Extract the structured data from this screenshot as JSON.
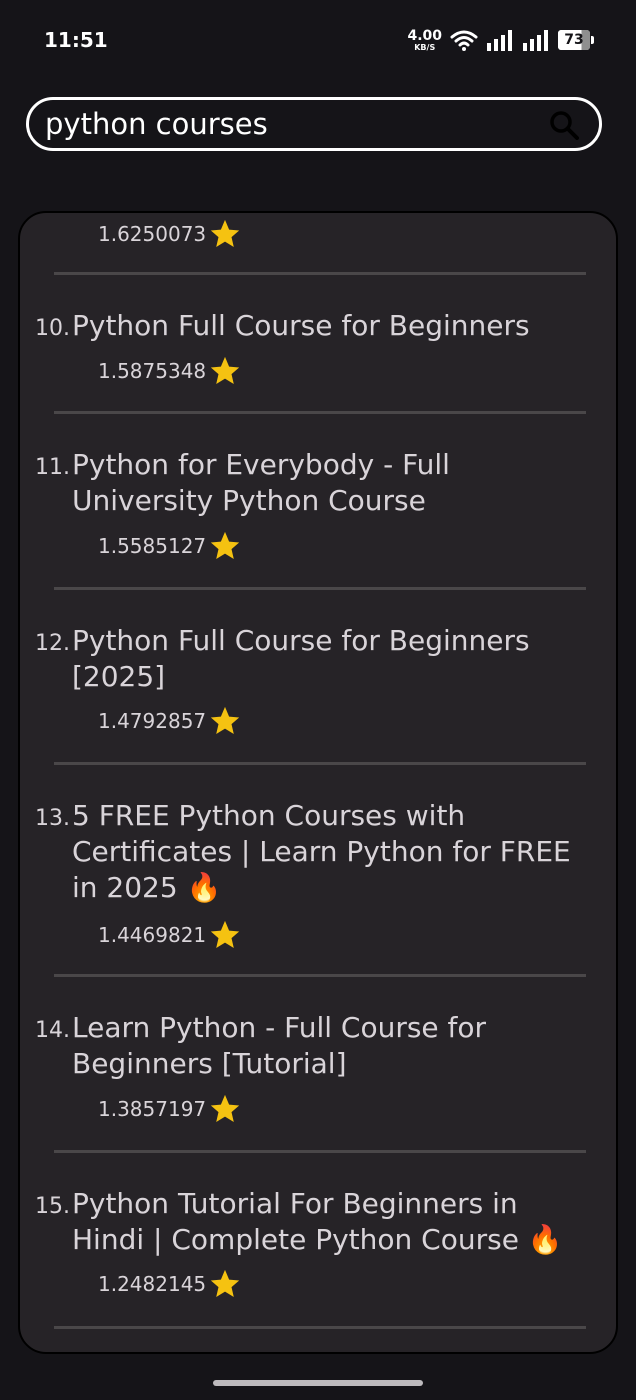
{
  "status_bar": {
    "time": "11:51",
    "net_speed_value": "4.00",
    "net_speed_unit": "KB/S",
    "battery": "73"
  },
  "search": {
    "value": "python courses",
    "placeholder": ""
  },
  "results": [
    {
      "index": "",
      "title": "",
      "score": "1.6250073"
    },
    {
      "index": "10.",
      "title": "Python Full Course for Beginners",
      "score": "1.5875348"
    },
    {
      "index": "11.",
      "title": "Python for Everybody - Full University Python Course",
      "score": "1.5585127"
    },
    {
      "index": "12.",
      "title": "Python Full Course for Beginners [2025]",
      "score": "1.4792857"
    },
    {
      "index": "13.",
      "title": "5 FREE Python Courses with Certificates | Learn Python for FREE in 2025 🔥",
      "score": "1.4469821"
    },
    {
      "index": "14.",
      "title": "Learn Python - Full Course for Beginners [Tutorial]",
      "score": "1.3857197"
    },
    {
      "index": "15.",
      "title": "Python Tutorial For Beginners in Hindi | Complete Python Course 🔥",
      "score": "1.2482145"
    }
  ],
  "colors": {
    "background": "#151418",
    "card": "#262327",
    "star": "#f5c211",
    "text": "#d9d4d9"
  },
  "icons": {
    "search": "search-icon",
    "rating": "star-icon",
    "wifi": "wifi-icon",
    "signal": "signal-icon",
    "battery": "battery-icon"
  }
}
